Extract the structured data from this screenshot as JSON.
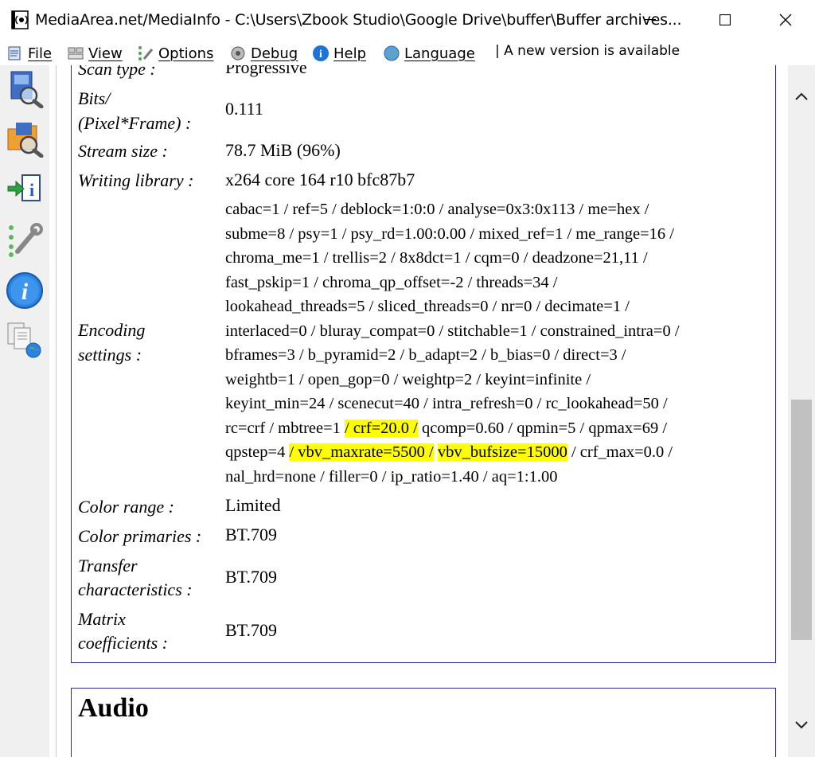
{
  "window": {
    "title": "MediaArea.net/MediaInfo - C:\\Users\\Zbook Studio\\Google Drive\\buffer\\Buffer archives..."
  },
  "menu": {
    "file": "File",
    "view": "View",
    "options": "Options",
    "debug": "Debug",
    "help": "Help",
    "language": "Language",
    "update": "| A new version is available"
  },
  "toolbar_icons": [
    "open-file-icon",
    "open-folder-icon",
    "export-icon",
    "preferences-icon",
    "about-icon",
    "web-sheets-icon"
  ],
  "video": {
    "scan_type": {
      "label": "Scan type :",
      "value": "Progressive"
    },
    "bits": {
      "label1": "Bits/",
      "label2": "(Pixel*Frame) :",
      "value": "0.111"
    },
    "stream_size": {
      "label": "Stream size :",
      "value": "78.7 MiB (96%)"
    },
    "writing_library": {
      "label": "Writing library :",
      "value": "x264 core 164 r10 bfc87b7"
    },
    "encoding_settings": {
      "label1": "Encoding",
      "label2": "settings :",
      "lines": [
        "cabac=1 / ref=5 / deblock=1:0:0 / analyse=0x3:0x113 / me=hex /",
        "subme=8 / psy=1 / psy_rd=1.00:0.00 / mixed_ref=1 / me_range=16 /",
        "chroma_me=1 / trellis=2 / 8x8dct=1 / cqm=0 / deadzone=21,11 /",
        "fast_pskip=1 / chroma_qp_offset=-2 / threads=34 /",
        "lookahead_threads=5 / sliced_threads=0 / nr=0 / decimate=1 /",
        "interlaced=0 / bluray_compat=0 / stitchable=1 / constrained_intra=0 /",
        "bframes=3 / b_pyramid=2 / b_adapt=2 / b_bias=0 / direct=3 /",
        "weightb=1 / open_gop=0 / weightp=2 / keyint=infinite /",
        "keyint_min=24 / scenecut=40 / intra_refresh=0 / rc_lookahead=50 /"
      ],
      "line10": {
        "pre": "rc=crf / mbtree=1 ",
        "hl": "/ crf=20.0 /",
        "post": " qcomp=0.60 / qpmin=5 / qpmax=69 /"
      },
      "line11": {
        "pre": "qpstep=4 ",
        "hl1": "/ vbv_maxrate=5500 /",
        "mid": " ",
        "hl2": "vbv_bufsize=15000",
        "post": " / crf_max=0.0 /"
      },
      "line12": "nal_hrd=none / filler=0 / ip_ratio=1.40 / aq=1:1.00"
    },
    "color_range": {
      "label": "Color range :",
      "value": "Limited"
    },
    "color_primaries": {
      "label": "Color primaries :",
      "value": "BT.709"
    },
    "transfer": {
      "label1": "Transfer",
      "label2": "characteristics :",
      "value": "BT.709"
    },
    "matrix": {
      "label1": "Matrix",
      "label2": "coefficients :",
      "value": "BT.709"
    }
  },
  "audio": {
    "heading": "Audio"
  },
  "colors": {
    "highlight": "#ffff00",
    "panel_border": "#2b2b8a"
  }
}
